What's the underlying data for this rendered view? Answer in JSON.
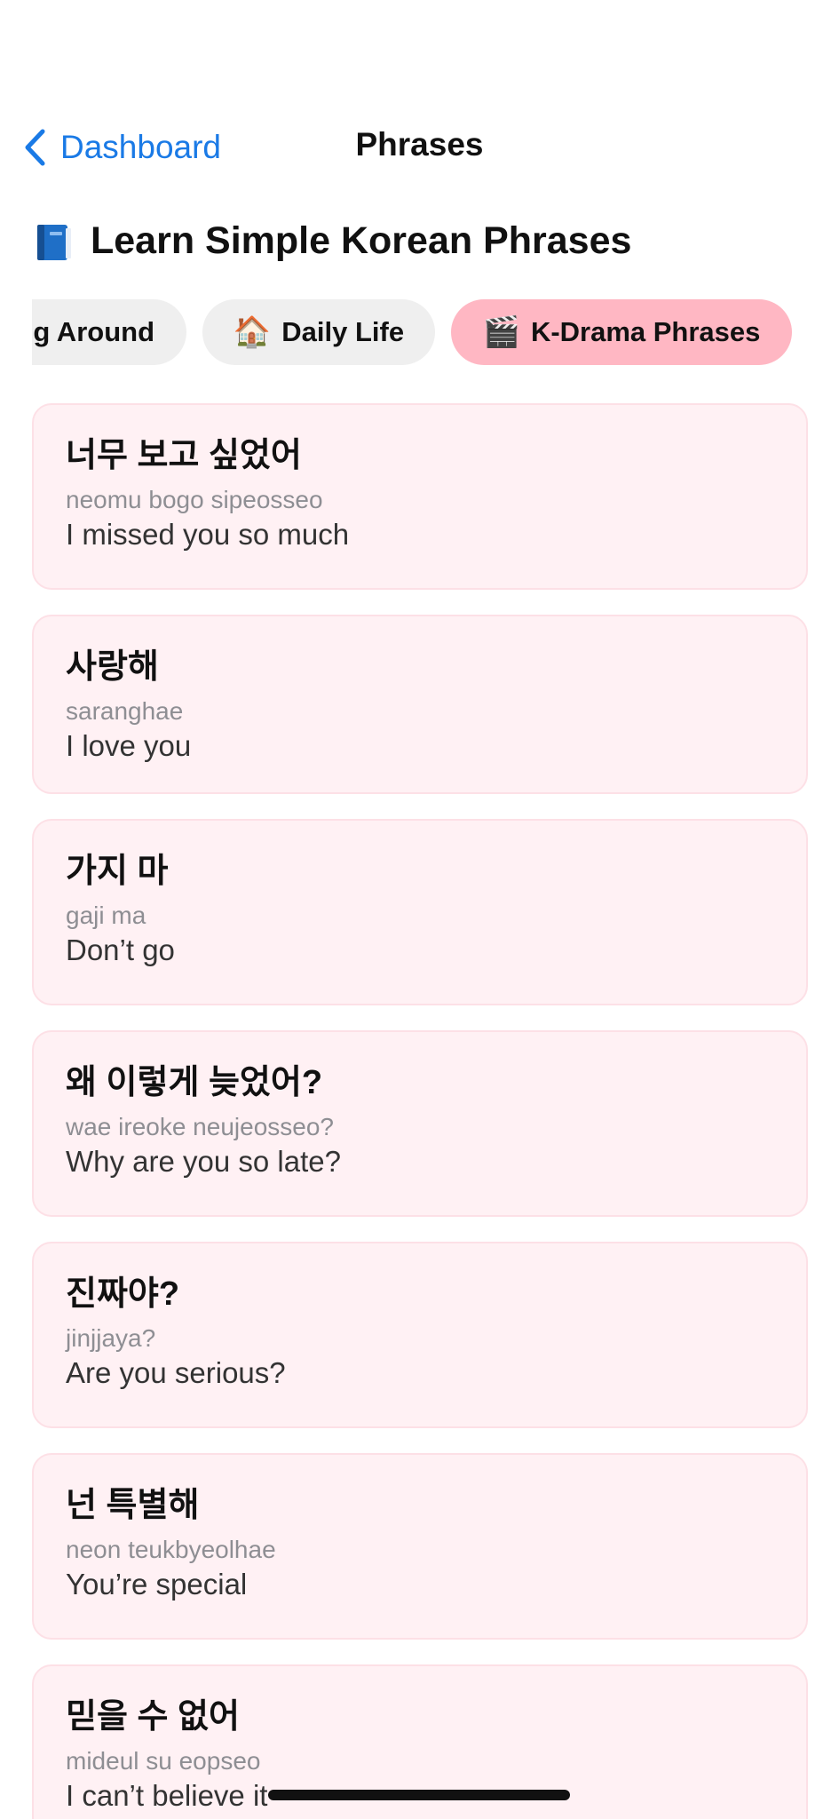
{
  "nav": {
    "back_label": "Dashboard",
    "title": "Phrases"
  },
  "page": {
    "title": "Learn Simple Korean Phrases",
    "title_icon": "blue-book-icon"
  },
  "categories": [
    {
      "label": "g Around",
      "icon": "",
      "active": false
    },
    {
      "label": "Daily Life",
      "icon": "🏠",
      "active": false
    },
    {
      "label": "K-Drama Phrases",
      "icon": "🎬",
      "active": true
    }
  ],
  "phrases": [
    {
      "korean": "너무 보고 싶었어",
      "romanization": "neomu bogo sipeosseo",
      "english": "I missed you so much"
    },
    {
      "korean": "사랑해",
      "romanization": "saranghae",
      "english": "I love you"
    },
    {
      "korean": "가지 마",
      "romanization": "gaji ma",
      "english": "Don’t go"
    },
    {
      "korean": "왜 이렇게 늦었어?",
      "romanization": "wae ireoke neujeosseo?",
      "english": "Why are you so late?"
    },
    {
      "korean": "진짜야?",
      "romanization": "jinjjaya?",
      "english": "Are you serious?"
    },
    {
      "korean": "넌 특별해",
      "romanization": "neon teukbyeolhae",
      "english": "You’re special"
    },
    {
      "korean": "믿을 수 없어",
      "romanization": "mideul su eopseo",
      "english": "I can’t believe it"
    }
  ],
  "colors": {
    "accent": "#1a7ae6",
    "active_chip": "#ffb7c3",
    "inactive_chip": "#efefef",
    "card_background": "#fff1f4",
    "card_border": "#fde0e6",
    "secondary_text": "#8e8e93"
  }
}
